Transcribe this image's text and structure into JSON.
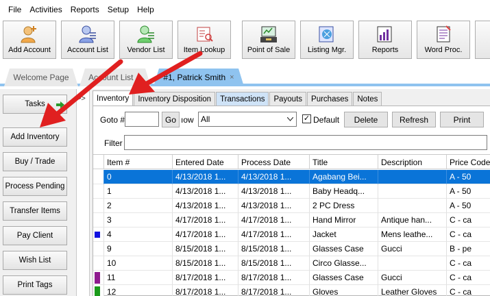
{
  "menu": [
    "File",
    "Activities",
    "Reports",
    "Setup",
    "Help"
  ],
  "toolbar": [
    {
      "label": "Add Account",
      "icon": "add-account-icon"
    },
    {
      "label": "Account List",
      "icon": "account-list-icon"
    },
    {
      "label": "Vendor List",
      "icon": "vendor-list-icon"
    },
    {
      "label": "Item Lookup",
      "icon": "item-lookup-icon"
    },
    {
      "label": "Point of Sale",
      "icon": "point-of-sale-icon"
    },
    {
      "label": "Listing Mgr.",
      "icon": "listing-manager-icon"
    },
    {
      "label": "Reports",
      "icon": "reports-icon"
    },
    {
      "label": "Word Proc.",
      "icon": "word-processor-icon"
    }
  ],
  "doc_tabs": [
    {
      "label": "Welcome Page",
      "close": ""
    },
    {
      "label": "Account List",
      "close": "×"
    },
    {
      "label": "#1, Patrick Smith",
      "close": "×"
    }
  ],
  "left_buttons": [
    "Tasks",
    "Add Inventory",
    "Buy / Trade",
    "Process Pending",
    "Transfer Items",
    "Pay Client",
    "Wish List",
    "Print Tags"
  ],
  "collapse_label": ">>",
  "inner_tabs": [
    "Inventory",
    "Inventory Disposition",
    "Transactions",
    "Payouts",
    "Purchases",
    "Notes"
  ],
  "controls": {
    "goto_label": "Goto #",
    "goto_value": "",
    "go_button": "Go",
    "show_label": "ıow",
    "show_value": "All",
    "default_label": "Default",
    "default_checked": "✓",
    "delete_button": "Delete",
    "refresh_button": "Refresh",
    "print_button": "Print",
    "filter_label": "Filter",
    "filter_value": ""
  },
  "grid": {
    "columns": [
      "Item #",
      "Entered Date",
      "Process Date",
      "Title",
      "Description",
      "Price Code"
    ],
    "rows": [
      {
        "item": "0",
        "entered": "4/13/2018 1...",
        "process": "4/13/2018 1...",
        "title": "Agabang Bei...",
        "desc": "",
        "price": "A - 50",
        "marker": ""
      },
      {
        "item": "1",
        "entered": "4/13/2018 1...",
        "process": "4/13/2018 1...",
        "title": "Baby Headq...",
        "desc": "",
        "price": "A - 50",
        "marker": ""
      },
      {
        "item": "2",
        "entered": "4/13/2018 1...",
        "process": "4/13/2018 1...",
        "title": "2 PC Dress",
        "desc": "",
        "price": "A - 50",
        "marker": ""
      },
      {
        "item": "3",
        "entered": "4/17/2018 1...",
        "process": "4/17/2018 1...",
        "title": "Hand Mirror",
        "desc": "Antique han...",
        "price": "C - ca",
        "marker": ""
      },
      {
        "item": "4",
        "entered": "4/17/2018 1...",
        "process": "4/17/2018 1...",
        "title": "Jacket",
        "desc": "Mens leathe...",
        "price": "C - ca",
        "marker": "#1010e0"
      },
      {
        "item": "9",
        "entered": "8/15/2018 1...",
        "process": "8/15/2018 1...",
        "title": "Glasses Case",
        "desc": "Gucci",
        "price": "B - pe",
        "marker": ""
      },
      {
        "item": "10",
        "entered": "8/15/2018 1...",
        "process": "8/15/2018 1...",
        "title": "Circo Glasse...",
        "desc": "",
        "price": "C - ca",
        "marker": ""
      },
      {
        "item": "11",
        "entered": "8/17/2018 1...",
        "process": "8/17/2018 1...",
        "title": "Glasses Case",
        "desc": "Gucci",
        "price": "C - ca",
        "marker": "#8e1b8e"
      },
      {
        "item": "12",
        "entered": "8/17/2018 1...",
        "process": "8/17/2018 1...",
        "title": "Gloves",
        "desc": "Leather Gloves",
        "price": "C - ca",
        "marker": "#1a9a1a"
      }
    ]
  },
  "colors": {
    "selection": "#0a74d8",
    "active_tab": "#8fc3ef",
    "arrow": "#e02020"
  }
}
